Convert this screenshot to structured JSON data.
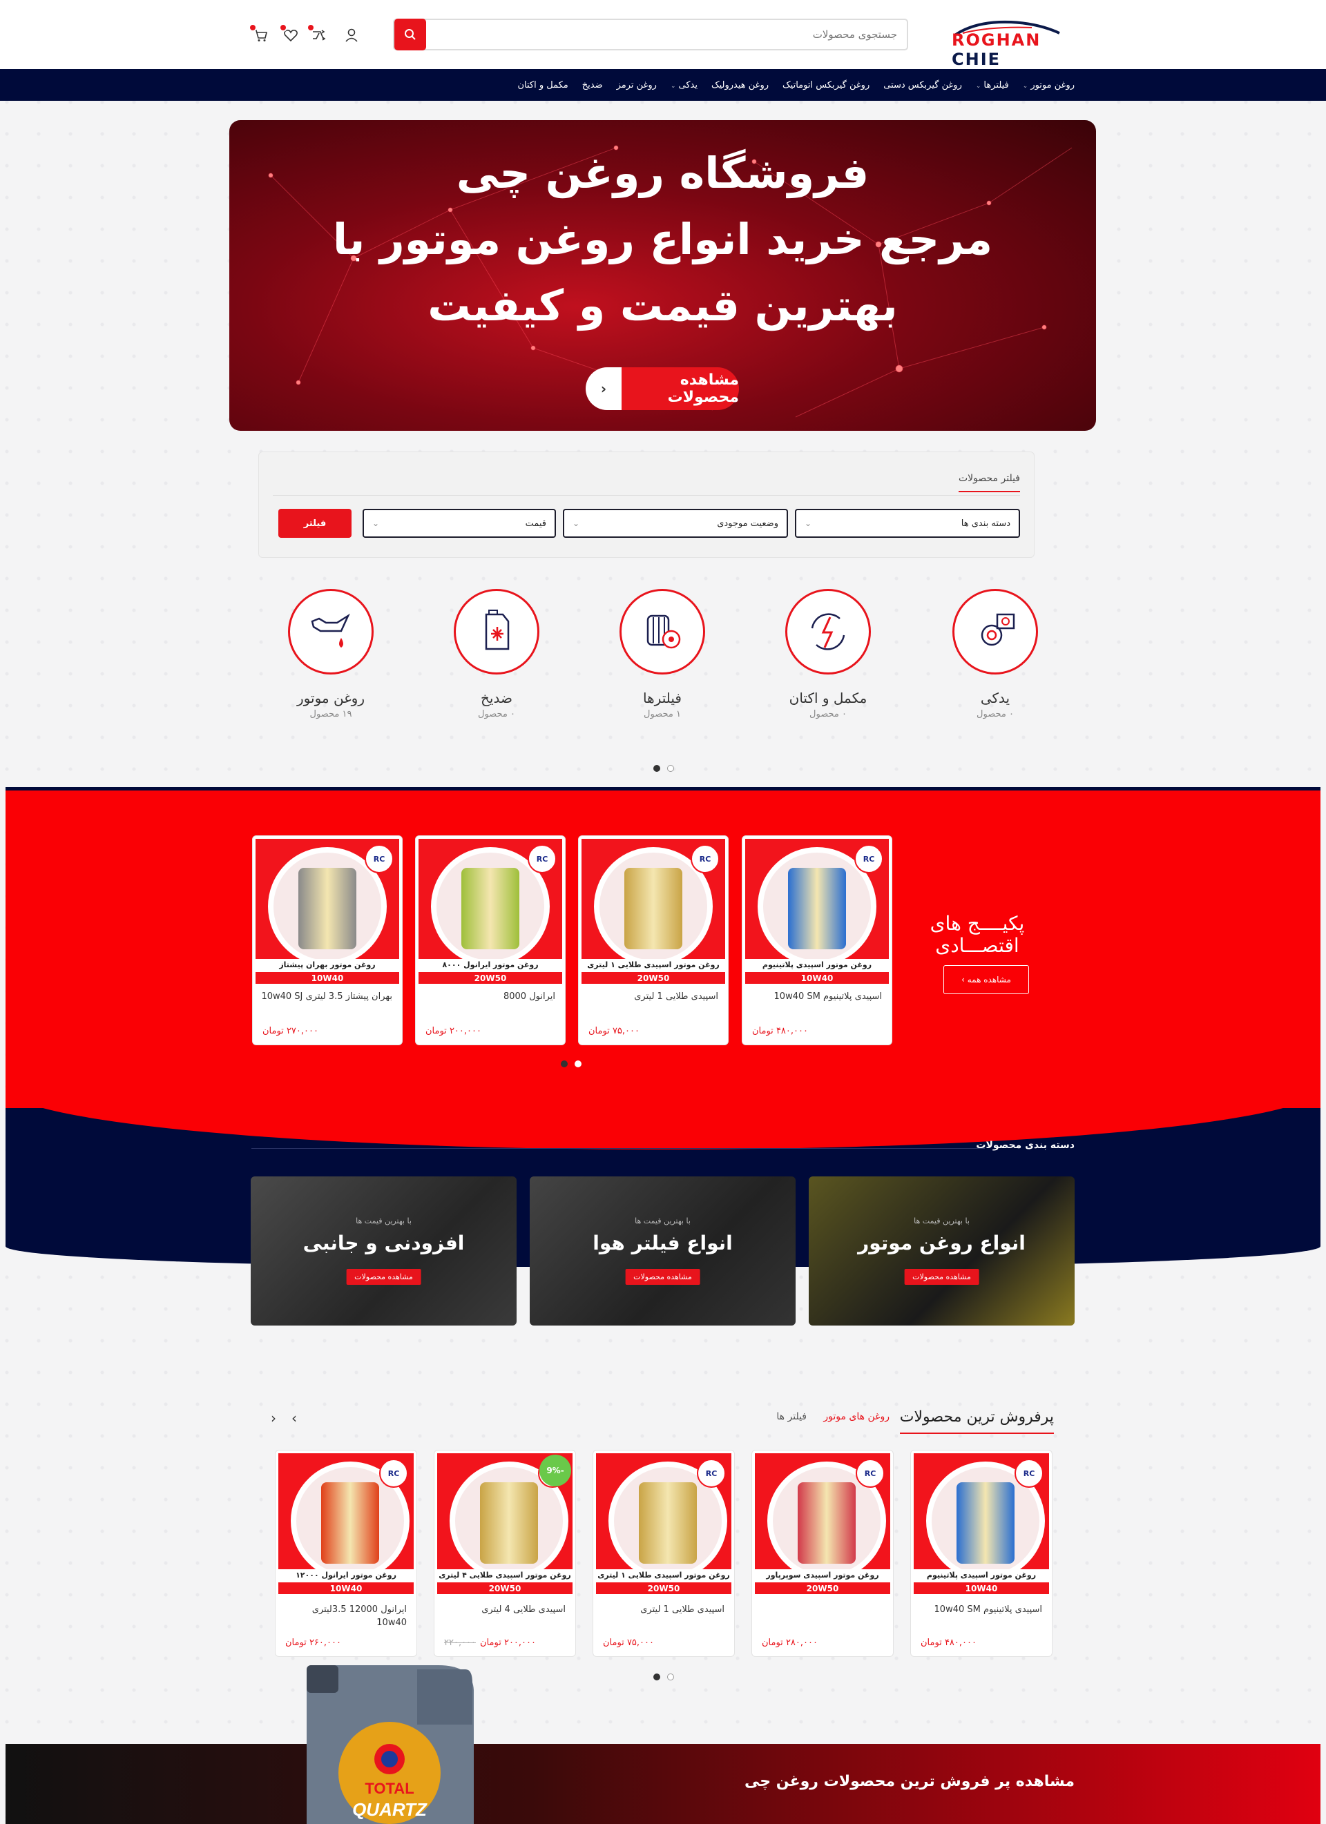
{
  "header": {
    "logo_text_a": "ROGHAN",
    "logo_text_b": "CHIE",
    "search_placeholder": "جستجوی محصولات",
    "icons": [
      "search-icon",
      "user-icon",
      "compare-icon",
      "heart-icon",
      "cart-icon"
    ]
  },
  "nav": {
    "items": [
      {
        "label": "روغن موتور",
        "dropdown": true
      },
      {
        "label": "فیلترها",
        "dropdown": true
      },
      {
        "label": "روغن گیربکس دستی",
        "dropdown": false
      },
      {
        "label": "روغن گیربکس اتوماتیک",
        "dropdown": false
      },
      {
        "label": "روغن هیدرولیک",
        "dropdown": false
      },
      {
        "label": "یدکی",
        "dropdown": true
      },
      {
        "label": "روغن ترمز",
        "dropdown": false
      },
      {
        "label": "ضدیخ",
        "dropdown": false
      },
      {
        "label": "مکمل و اکتان",
        "dropdown": false
      }
    ]
  },
  "hero": {
    "line1": "فروشگاه روغن چی",
    "line2": "مرجع خرید انواع روغن موتور با",
    "line3": "بهترین قیمت و کیفیت",
    "button": "مشاهده محصولات"
  },
  "filter": {
    "title": "فیلتر محصولات",
    "category": "دسته بندی ها",
    "stock": "وضعیت موجودی",
    "price": "قیمت",
    "button": "فیلتر"
  },
  "categories": [
    {
      "name": "یدکی",
      "count": "۰ محصول",
      "icon": "gears-icon"
    },
    {
      "name": "مکمل و اکتان",
      "count": "۰ محصول",
      "icon": "power-icon"
    },
    {
      "name": "فیلترها",
      "count": "۱ محصول",
      "icon": "filter-icon"
    },
    {
      "name": "ضدیخ",
      "count": "۰ محصول",
      "icon": "antifreeze-icon"
    },
    {
      "name": "روغن موتور",
      "count": "۱۹ محصول",
      "icon": "oil-can-icon"
    }
  ],
  "packages": {
    "title": "پکیــــج های اقتصـــادی",
    "button": "مشاهده همه",
    "products": [
      {
        "name": "اسپیدی پلاتینیوم 10w40 SM",
        "price": "۴۸۰,۰۰۰ تومان",
        "label": "روغن موتور اسپیدی پلاتینیوم",
        "grade": "10W40",
        "color": "#2b6fd0"
      },
      {
        "name": "اسپیدی طلایی 1 لیتری",
        "price": "۷۵,۰۰۰ تومان",
        "label": "روغن موتور اسپیدی طلایی ۱ لیتری",
        "grade": "20W50",
        "color": "#c9a446"
      },
      {
        "name": "ایرانول 8000",
        "price": "۲۰۰,۰۰۰ تومان",
        "label": "روغن موتور ایرانول ۸۰۰۰",
        "grade": "20W50",
        "color": "#9fbf3a"
      },
      {
        "name": "بهران پیشتاز 3.5 لیتری 10w40 SJ",
        "price": "۲۷۰,۰۰۰ تومان",
        "label": "روغن موتور بهران پیشتاز",
        "grade": "10W40",
        "color": "#8a8a8a"
      }
    ]
  },
  "category_banners": {
    "heading": "دسته بندی محصولات",
    "items": [
      {
        "sub": "با بهترین قیمت ها",
        "title": "انواع روغن موتور",
        "button": "مشاهده محصولات"
      },
      {
        "sub": "با بهترین قیمت ها",
        "title": "انواع فیلتر هوا",
        "button": "مشاهده محصولات"
      },
      {
        "sub": "با بهترین قیمت ها",
        "title": "افزودنی و جانبی",
        "button": "مشاهده محصولات"
      }
    ]
  },
  "bestsellers": {
    "title": "پرفروش ترین محصولات",
    "tabs": [
      "روغن های موتور",
      "فیلتر ها"
    ],
    "products": [
      {
        "name": "اسپیدی پلاتینیوم 10w40 SM",
        "price": "۴۸۰,۰۰۰ تومان",
        "old": "",
        "label": "روغن موتور اسپیدی پلاتینیوم",
        "grade": "10W40",
        "color": "#2b6fd0",
        "discount": ""
      },
      {
        "name": "",
        "price": "۲۸۰,۰۰۰ تومان",
        "old": "",
        "label": "روغن موتور اسپیدی سوپرپاور",
        "grade": "20W50",
        "color": "#d23a4a",
        "discount": ""
      },
      {
        "name": "اسپیدی طلایی 1 لیتری",
        "price": "۷۵,۰۰۰ تومان",
        "old": "",
        "label": "روغن موتور اسپیدی طلایی ۱ لیتری",
        "grade": "20W50",
        "color": "#c9a446",
        "discount": ""
      },
      {
        "name": "اسپیدی طلایی 4 لیتری",
        "price": "۲۰۰,۰۰۰ تومان",
        "old": "۲۲۰,۰۰۰",
        "label": "روغن موتور اسپیدی طلایی ۴ لیتری",
        "grade": "20W50",
        "color": "#c9a446",
        "discount": "-9%"
      },
      {
        "name": "ایرانول 12000 3.5لیتری 10w40",
        "price": "۲۶۰,۰۰۰ تومان",
        "old": "",
        "label": "روغن موتور ایرانول ۱۲۰۰۰",
        "grade": "10W40",
        "color": "#e0401a",
        "discount": ""
      }
    ]
  },
  "bottom_banner": {
    "title": "مشاهده پر فروش ترین محصولات روغن چی",
    "bottle_brand": "TOTAL",
    "bottle_product": "QUARTZ"
  },
  "colors": {
    "accent": "#e8141c",
    "navy": "#000a3a",
    "band_red": "#fa0005"
  }
}
